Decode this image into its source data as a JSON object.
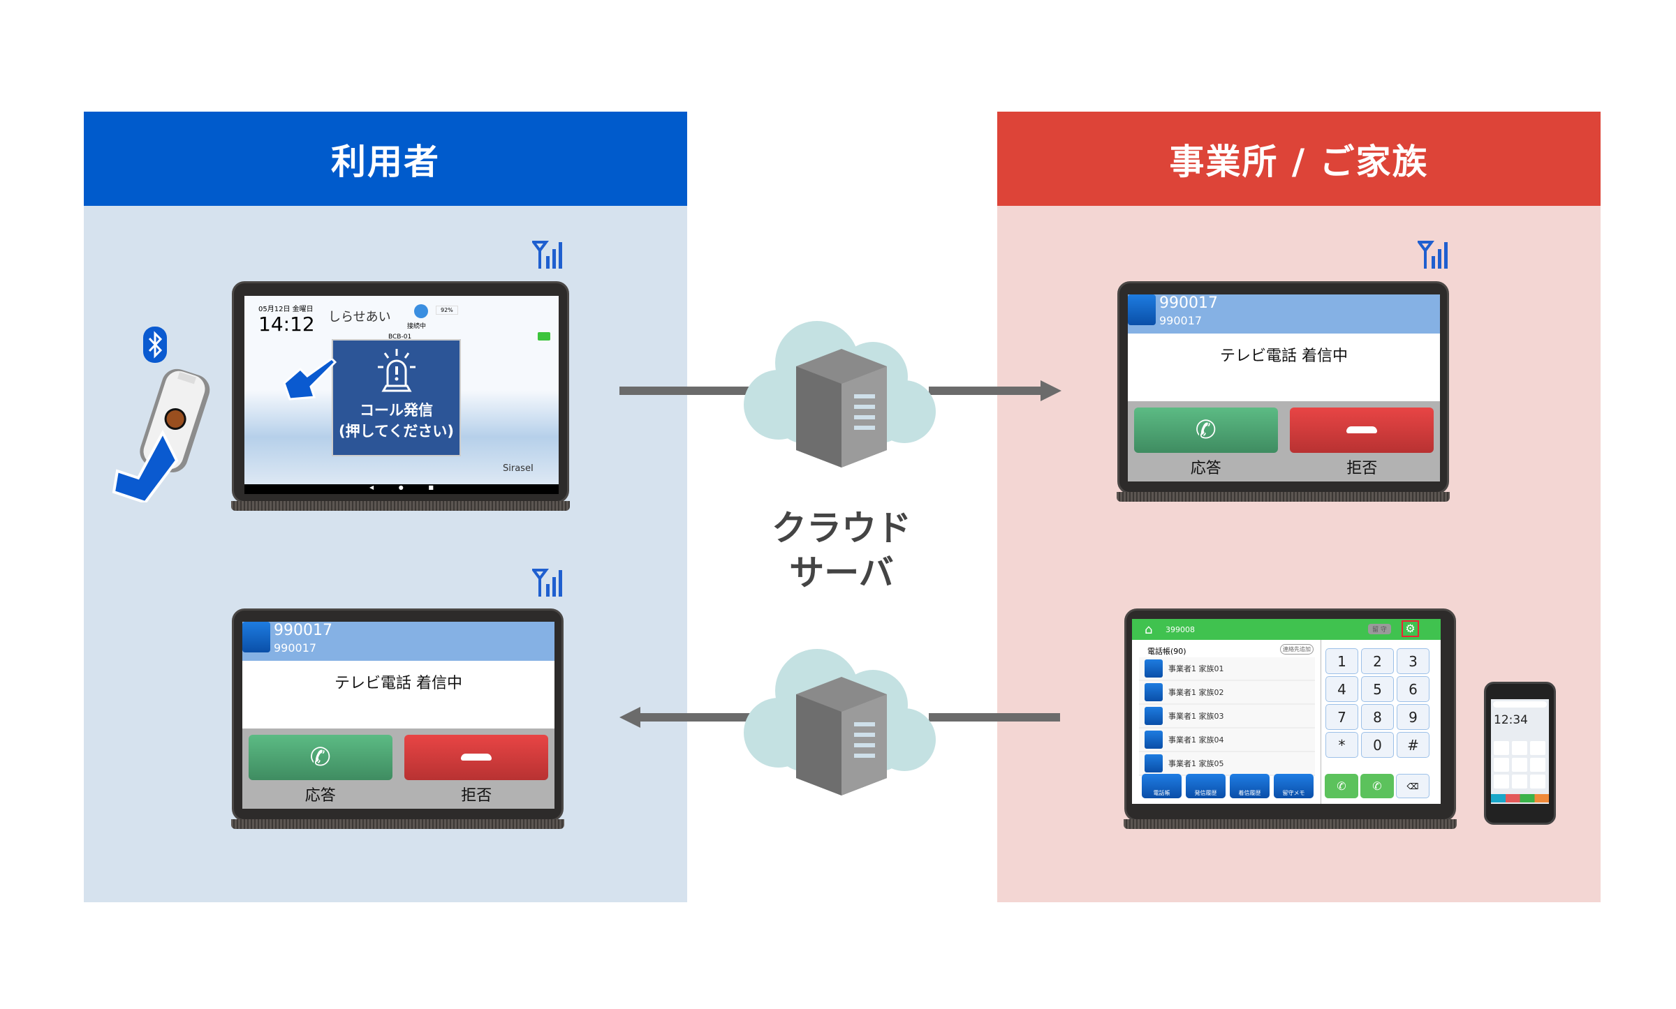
{
  "left_panel": {
    "title": "利用者",
    "header_color": "#005BCC",
    "body_color": "#D6E2EE"
  },
  "right_panel": {
    "title": "事業所 / ご家族",
    "header_color": "#DD4438",
    "body_color": "#F3D6D3"
  },
  "cloud": {
    "label_line1": "クラウド",
    "label_line2": "サーバ",
    "icons": [
      "cloud-icon",
      "server-icon"
    ]
  },
  "call_tablet": {
    "date": "05月12日 金曜日",
    "time": "14:12",
    "app_name": "しらせあい",
    "status": "接続中",
    "battery": "92%",
    "device_id": "BCB-01",
    "call_button_line1": "コール発信",
    "call_button_line2": "(押してください)",
    "brand": "SiraseI"
  },
  "incoming_call": {
    "caller_name": "990017",
    "caller_number": "990017",
    "message": "テレビ電話 着信中",
    "answer_label": "応答",
    "reject_label": "拒否",
    "answer_color": "#4FA474",
    "reject_color": "#D83A3A"
  },
  "phonebook_tablet": {
    "user_id": "399008",
    "away_button": "留 守",
    "phonebook_title": "電話帳(90)",
    "add_contact": "連絡先追加",
    "contacts": [
      "事業者1 家族01",
      "事業者1 家族02",
      "事業者1 家族03",
      "事業者1 家族04",
      "事業者1 家族05"
    ],
    "keys": [
      "1",
      "2",
      "3",
      "4",
      "5",
      "6",
      "7",
      "8",
      "9",
      "*",
      "0",
      "#"
    ],
    "nav": [
      "電話帳",
      "発信履歴",
      "着信履歴",
      "留守メモ"
    ]
  },
  "smartphone": {
    "time": "12:34"
  }
}
